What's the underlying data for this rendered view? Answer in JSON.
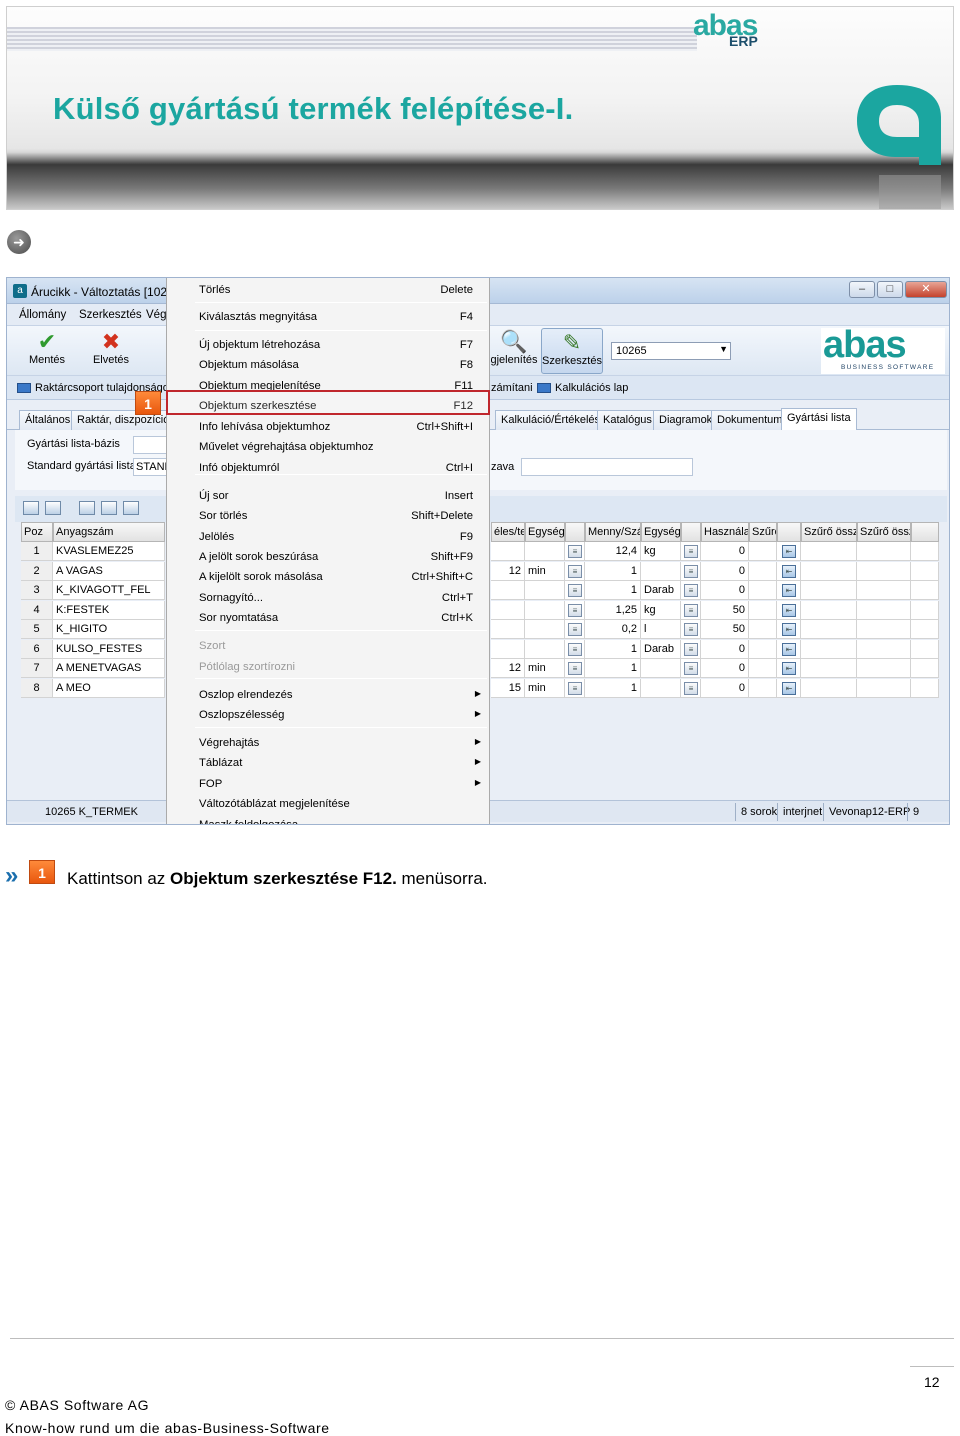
{
  "slide": {
    "title": "Külső gyártású termék felépítése-I.",
    "logo_word": "abas",
    "logo_sub": "ERP"
  },
  "window": {
    "title": "Árucikk - Változtatás  [1026",
    "menu": [
      "Állomány",
      "Szerkesztés",
      "Vég"
    ],
    "toolbar": {
      "save": "Mentés",
      "discard": "Elvetés",
      "display_partial": "gjelenítés",
      "edit": "Szerkesztés",
      "combo_value": "10265"
    },
    "brand": {
      "word": "abas",
      "sub": "BUSINESS SOFTWARE"
    },
    "subbar": {
      "left": "Raktárcsoport tulajdonságok",
      "mid": "zámítani",
      "right": "Kalkulációs lap"
    },
    "tabs": [
      "Általános",
      "Raktár, diszpozíció, ",
      "Kalkuláció/Értékelés",
      "Katalógus",
      "Diagramok",
      "Dokumentum",
      "Gyártási lista"
    ],
    "form": {
      "label1": "Gyártási lista-bázis",
      "label2": "Standard gyártási lista",
      "value2": "STAND",
      "right_label": "zava"
    },
    "grid": {
      "headers": [
        "Poz",
        "Anyagszám",
        "éles/te",
        "Egység",
        "Menny/Szá",
        "Egység",
        "Használat",
        "Szűrő",
        "Szűrő össz",
        "Szűrő össz"
      ],
      "rows": [
        {
          "pos": "1",
          "item": "KVASLEMEZ25",
          "time": "",
          "tunit": "",
          "qty": "12,4",
          "unit": "kg",
          "use": "0"
        },
        {
          "pos": "2",
          "item": "A VAGAS",
          "time": "12",
          "tunit": "min",
          "qty": "1",
          "unit": "",
          "use": "0"
        },
        {
          "pos": "3",
          "item": "K_KIVAGOTT_FEL",
          "time": "",
          "tunit": "",
          "qty": "1",
          "unit": "Darab",
          "use": "0"
        },
        {
          "pos": "4",
          "item": "K:FESTEK",
          "time": "",
          "tunit": "",
          "qty": "1,25",
          "unit": "kg",
          "use": "50"
        },
        {
          "pos": "5",
          "item": "K_HIGITO",
          "time": "",
          "tunit": "",
          "qty": "0,2",
          "unit": "l",
          "use": "50"
        },
        {
          "pos": "6",
          "item": "KULSO_FESTES",
          "time": "",
          "tunit": "",
          "qty": "1",
          "unit": "Darab",
          "use": "0"
        },
        {
          "pos": "7",
          "item": "A MENETVAGAS",
          "time": "12",
          "tunit": "min",
          "qty": "1",
          "unit": "",
          "use": "0"
        },
        {
          "pos": "8",
          "item": "A MEO",
          "time": "15",
          "tunit": "min",
          "qty": "1",
          "unit": "",
          "use": "0"
        }
      ]
    },
    "status": {
      "left": "10265 K_TERMEK",
      "rows": "8 sorok",
      "net": "interjnet",
      "server": "Vevonap12-ERP",
      "n": "9"
    }
  },
  "context_menu": [
    {
      "label": "Törlés",
      "key": "Delete"
    },
    {
      "label": "Kiválasztás megnyitása",
      "key": "F4"
    },
    {
      "label": "Új objektum létrehozása",
      "key": "F7"
    },
    {
      "label": "Objektum másolása",
      "key": "F8"
    },
    {
      "label": "Objektum megjelenítése",
      "key": "F11"
    },
    {
      "label": "Objektum szerkesztése",
      "key": "F12"
    },
    {
      "label": "Info lehívása objektumhoz",
      "key": "Ctrl+Shift+I"
    },
    {
      "label": "Művelet végrehajtása objektumhoz",
      "key": ""
    },
    {
      "label": "Infó objektumról",
      "key": "Ctrl+I"
    },
    {
      "label": "Új sor",
      "key": "Insert"
    },
    {
      "label": "Sor törlés",
      "key": "Shift+Delete"
    },
    {
      "label": "Jelölés",
      "key": "F9"
    },
    {
      "label": "A jelölt sorok beszúrása",
      "key": "Shift+F9"
    },
    {
      "label": "A kijelölt sorok másolása",
      "key": "Ctrl+Shift+C"
    },
    {
      "label": "Sornagyító...",
      "key": "Ctrl+T"
    },
    {
      "label": "Sor nyomtatása",
      "key": "Ctrl+K"
    },
    {
      "label": "Szort",
      "key": ""
    },
    {
      "label": "Pótlólag szortírozni",
      "key": ""
    },
    {
      "label": "Oszlop elrendezés",
      "key": ""
    },
    {
      "label": "Oszlopszélesség",
      "key": ""
    },
    {
      "label": "Végrehajtás",
      "key": ""
    },
    {
      "label": "Táblázat",
      "key": ""
    },
    {
      "label": "FOP",
      "key": ""
    },
    {
      "label": "Változótáblázat megjelenítése",
      "key": ""
    },
    {
      "label": "Maszk feldolgozása",
      "key": ""
    }
  ],
  "callout_number": "1",
  "caption": {
    "pre": "Kattintson  az ",
    "bold": "Objektum szerkesztése F12.",
    "post": "  menüsorra."
  },
  "footer": {
    "page": "12",
    "copyright": "© ABAS Software AG",
    "tagline": "Know-how rund um die abas-Business-Software"
  }
}
